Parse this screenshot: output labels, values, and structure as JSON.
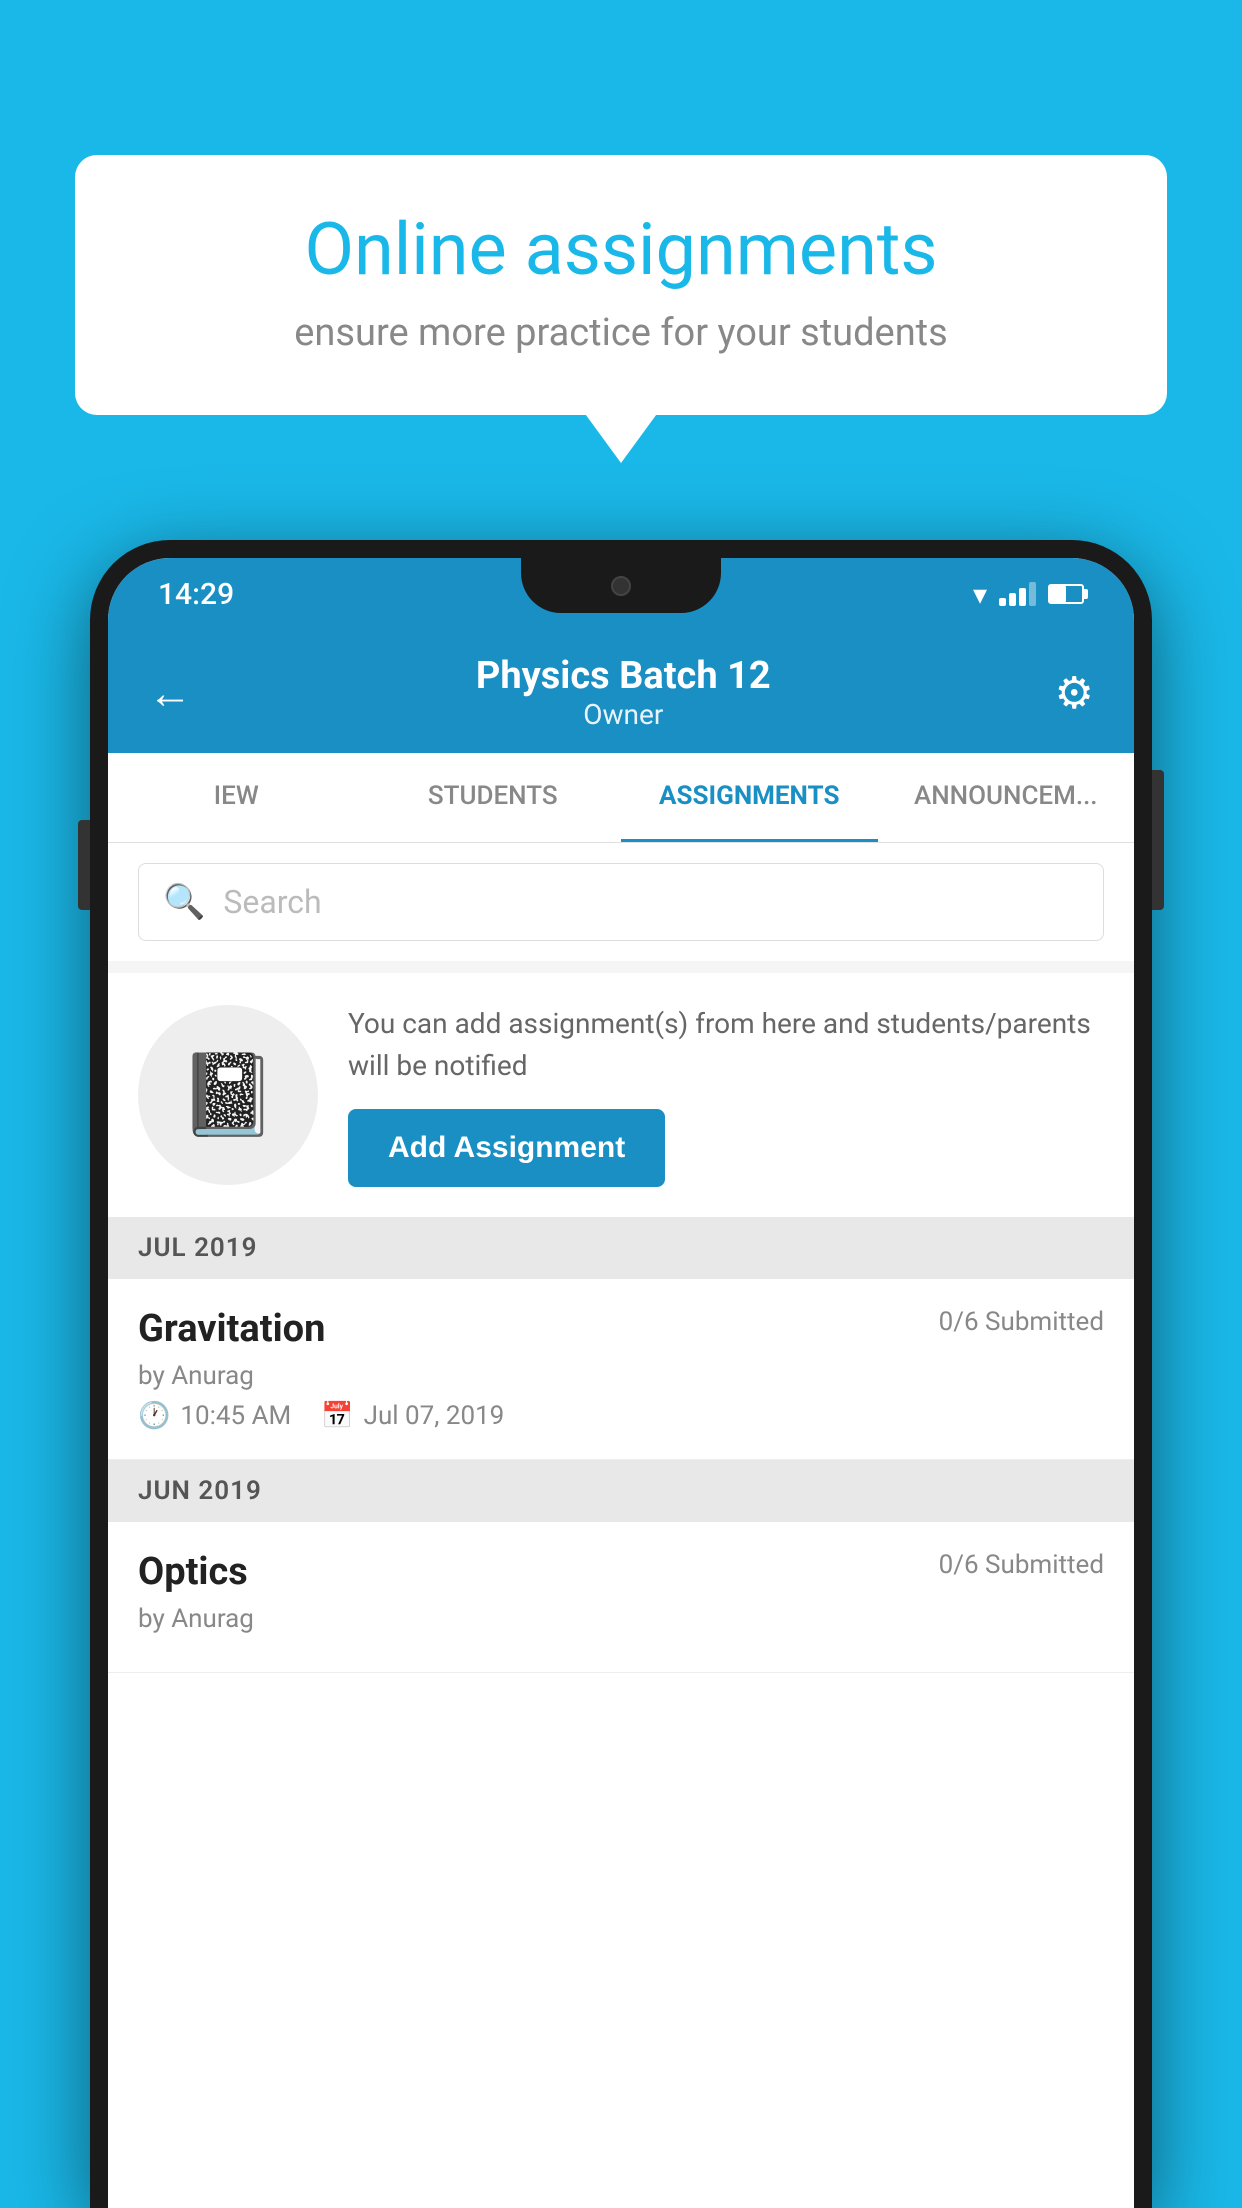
{
  "background_color": "#1ab8e8",
  "speech_bubble": {
    "title": "Online assignments",
    "subtitle": "ensure more practice for your students"
  },
  "status_bar": {
    "time": "14:29"
  },
  "app_header": {
    "title": "Physics Batch 12",
    "subtitle": "Owner",
    "back_label": "←",
    "settings_label": "⚙"
  },
  "tabs": [
    {
      "label": "IEW",
      "active": false
    },
    {
      "label": "STUDENTS",
      "active": false
    },
    {
      "label": "ASSIGNMENTS",
      "active": true
    },
    {
      "label": "ANNOUNCEM...",
      "active": false
    }
  ],
  "search": {
    "placeholder": "Search"
  },
  "promo": {
    "description": "You can add assignment(s) from here and students/parents will be notified",
    "button_label": "Add Assignment"
  },
  "sections": [
    {
      "month": "JUL 2019",
      "assignments": [
        {
          "name": "Gravitation",
          "submitted": "0/6 Submitted",
          "author": "by Anurag",
          "time": "10:45 AM",
          "date": "Jul 07, 2019"
        }
      ]
    },
    {
      "month": "JUN 2019",
      "assignments": [
        {
          "name": "Optics",
          "submitted": "0/6 Submitted",
          "author": "by Anurag",
          "time": "",
          "date": ""
        }
      ]
    }
  ]
}
